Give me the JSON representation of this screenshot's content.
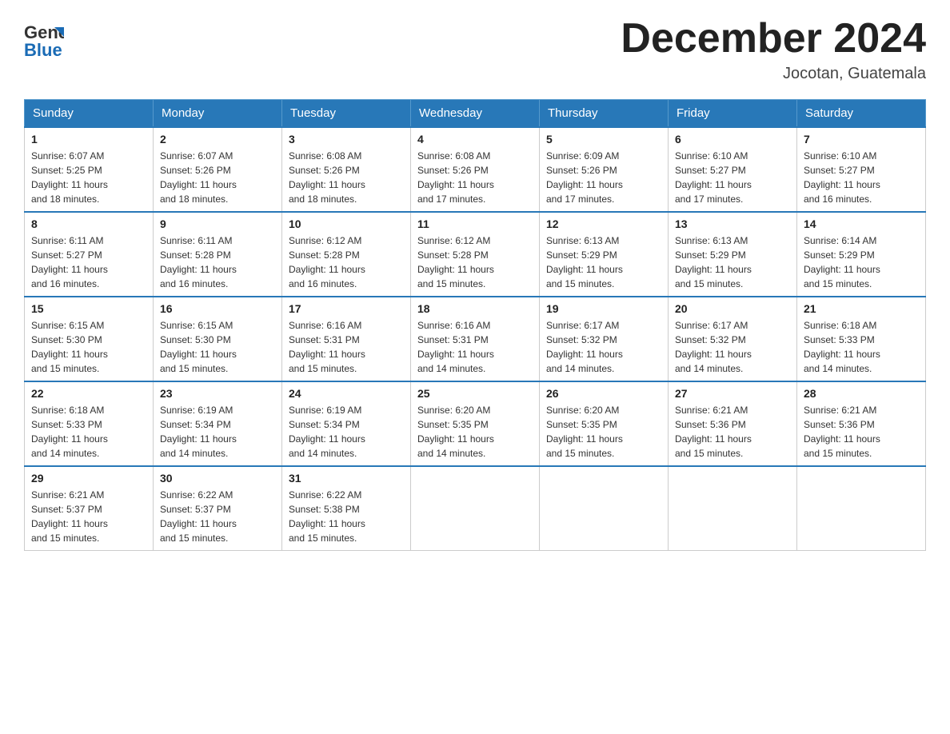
{
  "logo": {
    "general": "General",
    "blue": "Blue"
  },
  "title": "December 2024",
  "location": "Jocotan, Guatemala",
  "days_of_week": [
    "Sunday",
    "Monday",
    "Tuesday",
    "Wednesday",
    "Thursday",
    "Friday",
    "Saturday"
  ],
  "weeks": [
    [
      {
        "day": "1",
        "sunrise": "6:07 AM",
        "sunset": "5:25 PM",
        "daylight": "11 hours and 18 minutes."
      },
      {
        "day": "2",
        "sunrise": "6:07 AM",
        "sunset": "5:26 PM",
        "daylight": "11 hours and 18 minutes."
      },
      {
        "day": "3",
        "sunrise": "6:08 AM",
        "sunset": "5:26 PM",
        "daylight": "11 hours and 18 minutes."
      },
      {
        "day": "4",
        "sunrise": "6:08 AM",
        "sunset": "5:26 PM",
        "daylight": "11 hours and 17 minutes."
      },
      {
        "day": "5",
        "sunrise": "6:09 AM",
        "sunset": "5:26 PM",
        "daylight": "11 hours and 17 minutes."
      },
      {
        "day": "6",
        "sunrise": "6:10 AM",
        "sunset": "5:27 PM",
        "daylight": "11 hours and 17 minutes."
      },
      {
        "day": "7",
        "sunrise": "6:10 AM",
        "sunset": "5:27 PM",
        "daylight": "11 hours and 16 minutes."
      }
    ],
    [
      {
        "day": "8",
        "sunrise": "6:11 AM",
        "sunset": "5:27 PM",
        "daylight": "11 hours and 16 minutes."
      },
      {
        "day": "9",
        "sunrise": "6:11 AM",
        "sunset": "5:28 PM",
        "daylight": "11 hours and 16 minutes."
      },
      {
        "day": "10",
        "sunrise": "6:12 AM",
        "sunset": "5:28 PM",
        "daylight": "11 hours and 16 minutes."
      },
      {
        "day": "11",
        "sunrise": "6:12 AM",
        "sunset": "5:28 PM",
        "daylight": "11 hours and 15 minutes."
      },
      {
        "day": "12",
        "sunrise": "6:13 AM",
        "sunset": "5:29 PM",
        "daylight": "11 hours and 15 minutes."
      },
      {
        "day": "13",
        "sunrise": "6:13 AM",
        "sunset": "5:29 PM",
        "daylight": "11 hours and 15 minutes."
      },
      {
        "day": "14",
        "sunrise": "6:14 AM",
        "sunset": "5:29 PM",
        "daylight": "11 hours and 15 minutes."
      }
    ],
    [
      {
        "day": "15",
        "sunrise": "6:15 AM",
        "sunset": "5:30 PM",
        "daylight": "11 hours and 15 minutes."
      },
      {
        "day": "16",
        "sunrise": "6:15 AM",
        "sunset": "5:30 PM",
        "daylight": "11 hours and 15 minutes."
      },
      {
        "day": "17",
        "sunrise": "6:16 AM",
        "sunset": "5:31 PM",
        "daylight": "11 hours and 15 minutes."
      },
      {
        "day": "18",
        "sunrise": "6:16 AM",
        "sunset": "5:31 PM",
        "daylight": "11 hours and 14 minutes."
      },
      {
        "day": "19",
        "sunrise": "6:17 AM",
        "sunset": "5:32 PM",
        "daylight": "11 hours and 14 minutes."
      },
      {
        "day": "20",
        "sunrise": "6:17 AM",
        "sunset": "5:32 PM",
        "daylight": "11 hours and 14 minutes."
      },
      {
        "day": "21",
        "sunrise": "6:18 AM",
        "sunset": "5:33 PM",
        "daylight": "11 hours and 14 minutes."
      }
    ],
    [
      {
        "day": "22",
        "sunrise": "6:18 AM",
        "sunset": "5:33 PM",
        "daylight": "11 hours and 14 minutes."
      },
      {
        "day": "23",
        "sunrise": "6:19 AM",
        "sunset": "5:34 PM",
        "daylight": "11 hours and 14 minutes."
      },
      {
        "day": "24",
        "sunrise": "6:19 AM",
        "sunset": "5:34 PM",
        "daylight": "11 hours and 14 minutes."
      },
      {
        "day": "25",
        "sunrise": "6:20 AM",
        "sunset": "5:35 PM",
        "daylight": "11 hours and 14 minutes."
      },
      {
        "day": "26",
        "sunrise": "6:20 AM",
        "sunset": "5:35 PM",
        "daylight": "11 hours and 15 minutes."
      },
      {
        "day": "27",
        "sunrise": "6:21 AM",
        "sunset": "5:36 PM",
        "daylight": "11 hours and 15 minutes."
      },
      {
        "day": "28",
        "sunrise": "6:21 AM",
        "sunset": "5:36 PM",
        "daylight": "11 hours and 15 minutes."
      }
    ],
    [
      {
        "day": "29",
        "sunrise": "6:21 AM",
        "sunset": "5:37 PM",
        "daylight": "11 hours and 15 minutes."
      },
      {
        "day": "30",
        "sunrise": "6:22 AM",
        "sunset": "5:37 PM",
        "daylight": "11 hours and 15 minutes."
      },
      {
        "day": "31",
        "sunrise": "6:22 AM",
        "sunset": "5:38 PM",
        "daylight": "11 hours and 15 minutes."
      },
      null,
      null,
      null,
      null
    ]
  ],
  "labels": {
    "sunrise": "Sunrise:",
    "sunset": "Sunset:",
    "daylight": "Daylight:"
  }
}
